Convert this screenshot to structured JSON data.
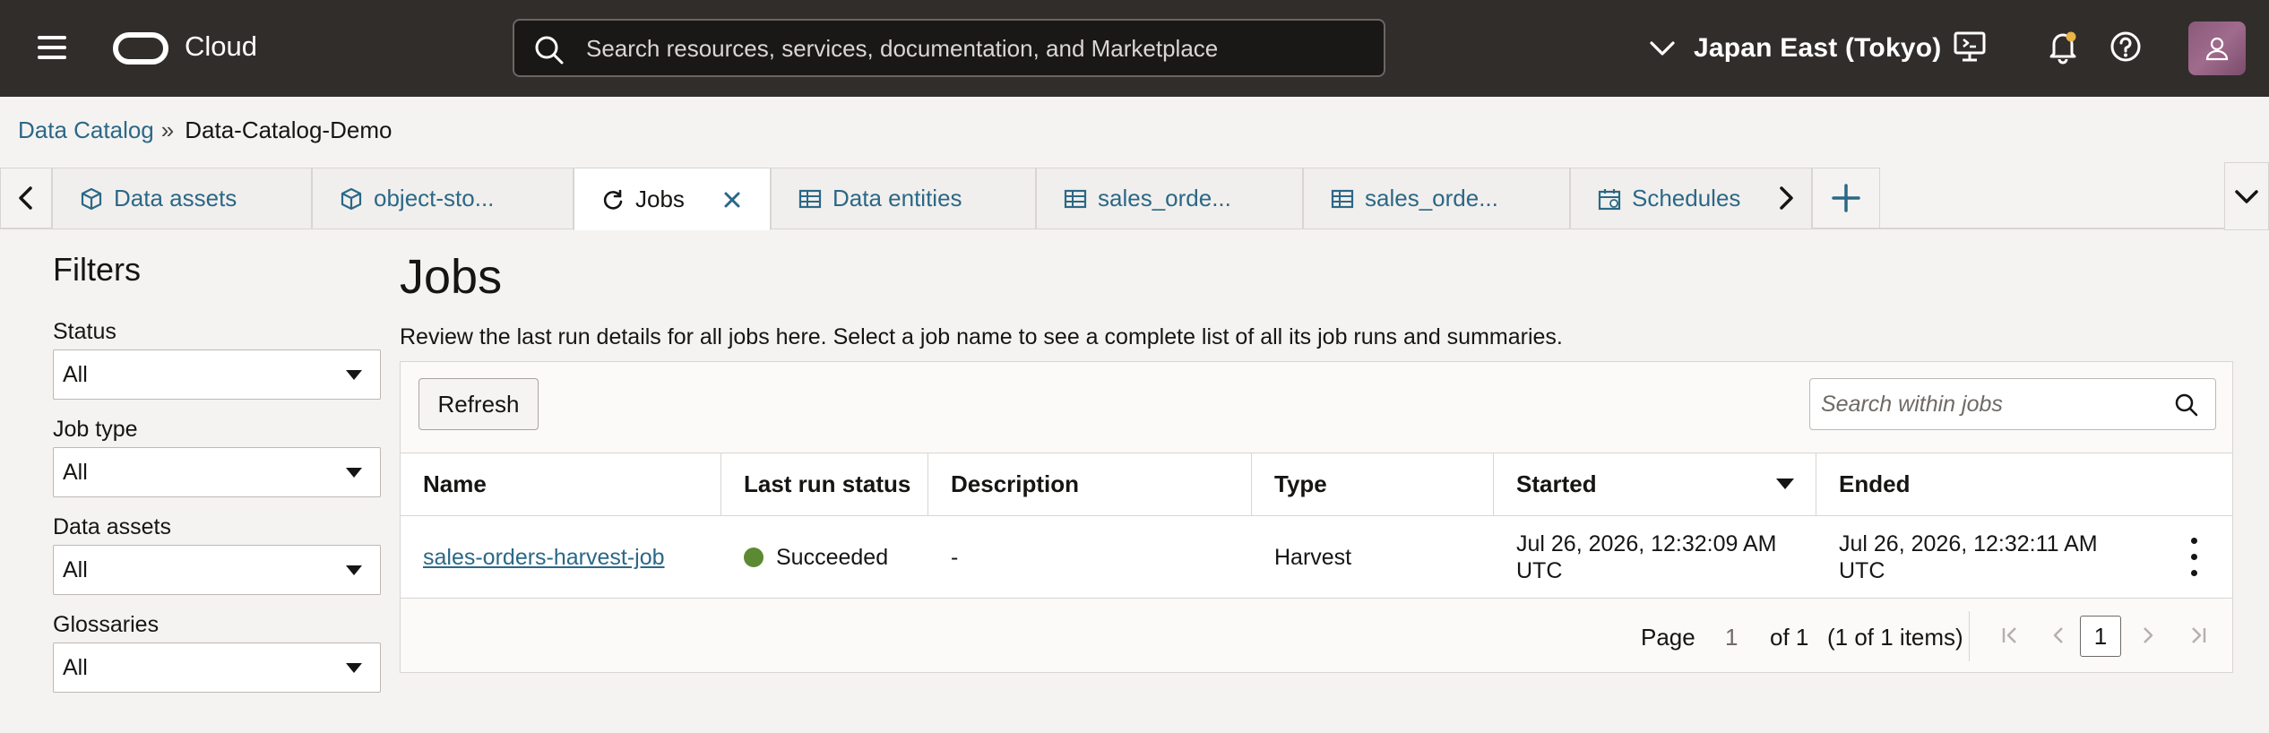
{
  "topbar": {
    "brand": "Cloud",
    "search_placeholder": "Search resources, services, documentation, and Marketplace",
    "region": "Japan East (Tokyo)"
  },
  "breadcrumb": {
    "parent": "Data Catalog",
    "separator": "»",
    "current": "Data-Catalog-Demo"
  },
  "tabs": [
    {
      "label": "Data assets",
      "icon": "cube-icon"
    },
    {
      "label": "object-sto...",
      "icon": "cube-icon"
    },
    {
      "label": "Jobs",
      "icon": "refresh-icon",
      "active": true
    },
    {
      "label": "Data entities",
      "icon": "table-icon"
    },
    {
      "label": "sales_orde...",
      "icon": "table-icon"
    },
    {
      "label": "sales_orde...",
      "icon": "table-icon"
    },
    {
      "label": "Schedules",
      "icon": "calendar-icon"
    }
  ],
  "filters": {
    "title": "Filters",
    "groups": [
      {
        "label": "Status",
        "value": "All"
      },
      {
        "label": "Job type",
        "value": "All"
      },
      {
        "label": "Data assets",
        "value": "All"
      },
      {
        "label": "Glossaries",
        "value": "All"
      }
    ]
  },
  "main": {
    "title": "Jobs",
    "description": "Review the last run details for all jobs here. Select a job name to see a complete list of all its job runs and summaries.",
    "refresh_label": "Refresh",
    "search_placeholder": "Search within jobs"
  },
  "table": {
    "columns": [
      "Name",
      "Last run status",
      "Description",
      "Type",
      "Started",
      "Ended"
    ],
    "rows": [
      {
        "name": "sales-orders-harvest-job",
        "status": "Succeeded",
        "description": "-",
        "type": "Harvest",
        "started_1": "Jul 26, 2026, 12:32:09 AM",
        "started_2": "UTC",
        "ended_1": "Jul 26, 2026, 12:32:11 AM",
        "ended_2": "UTC"
      }
    ]
  },
  "pager": {
    "page_label": "Page",
    "page_value": "1",
    "of_label": "of 1",
    "items_label": "(1 of 1 items)",
    "current": "1"
  },
  "colors": {
    "topbar": "#312d2a",
    "link": "#2b6887",
    "success": "#5b8a32"
  }
}
